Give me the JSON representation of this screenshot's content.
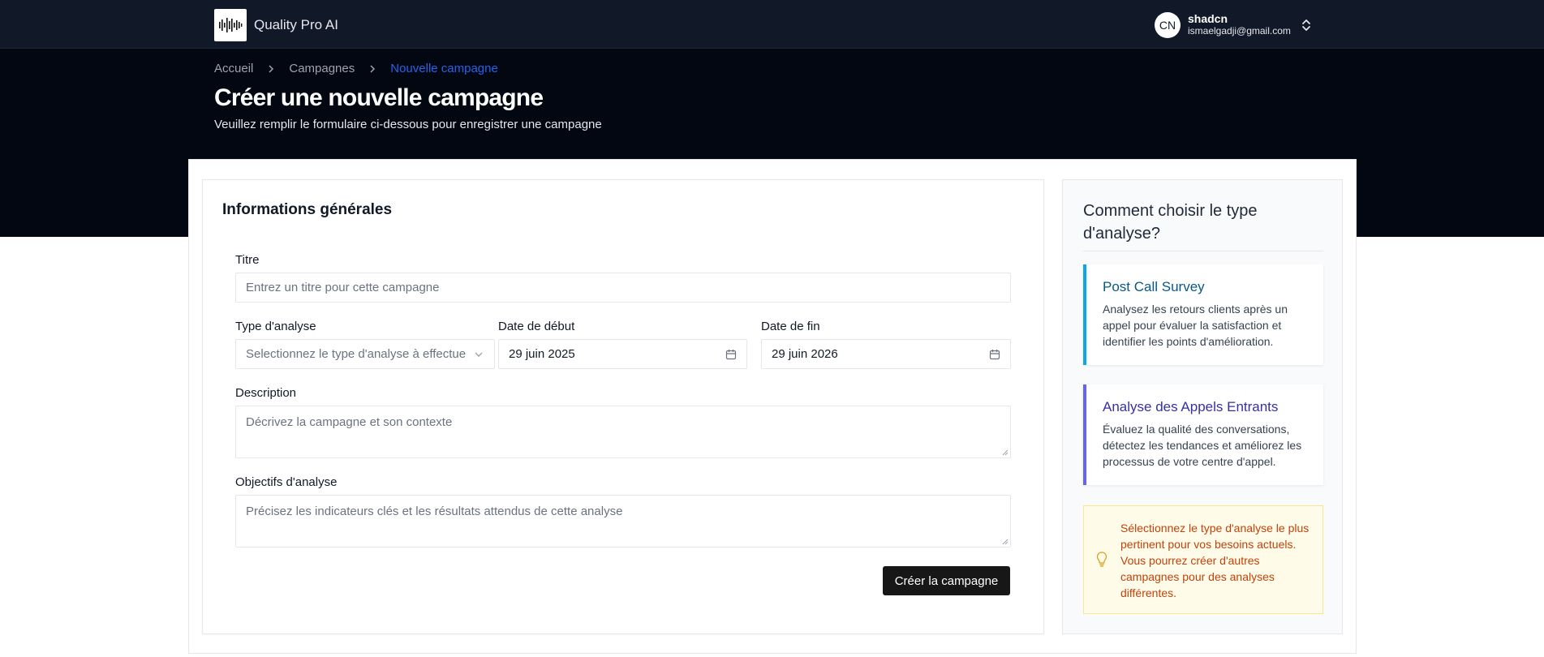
{
  "app": {
    "name": "Quality Pro AI",
    "logo_icon": "audio-waveform-icon"
  },
  "user": {
    "initials": "CN",
    "name": "shadcn",
    "email": "ismaelgadji@gmail.com"
  },
  "breadcrumb": [
    "Accueil",
    "Campagnes",
    "Nouvelle campagne"
  ],
  "page": {
    "title": "Créer une nouvelle campagne",
    "subtitle": "Veuillez remplir le formulaire ci-dessous pour enregistrer une campagne"
  },
  "form": {
    "section_title": "Informations générales",
    "titre": {
      "label": "Titre",
      "placeholder": "Entrez un titre pour cette campagne",
      "value": ""
    },
    "type_analyse": {
      "label": "Type d'analyse",
      "placeholder": "Selectionnez le type d'analyse à effectuer"
    },
    "date_debut": {
      "label": "Date de début",
      "value": "29 juin 2025"
    },
    "date_fin": {
      "label": "Date de fin",
      "value": "29 juin 2026"
    },
    "description": {
      "label": "Description",
      "placeholder": "Décrivez la campagne et son contexte"
    },
    "objectifs": {
      "label": "Objectifs d'analyse",
      "placeholder": "Précisez les indicateurs clés et les résultats attendus de cette analyse"
    },
    "submit_label": "Créer la campagne"
  },
  "sidebar": {
    "title": "Comment choisir le type d'analyse?",
    "cards": [
      {
        "title": "Post Call Survey",
        "text": "Analysez les retours clients après un appel pour évaluer la satisfaction et identifier les points d'amélioration.",
        "accent": "#0ea5e9"
      },
      {
        "title": "Analyse des Appels Entrants",
        "text": "Évaluez la qualité des conversations, détectez les tendances et améliorez les processus de votre centre d'appel.",
        "accent": "#6366f1"
      }
    ],
    "tip": {
      "icon": "lightbulb-icon",
      "text": "Sélectionnez le type d'analyse le plus pertinent pour vos besoins actuels. Vous pourrez créer d'autres campagnes pour des analyses différentes."
    }
  }
}
